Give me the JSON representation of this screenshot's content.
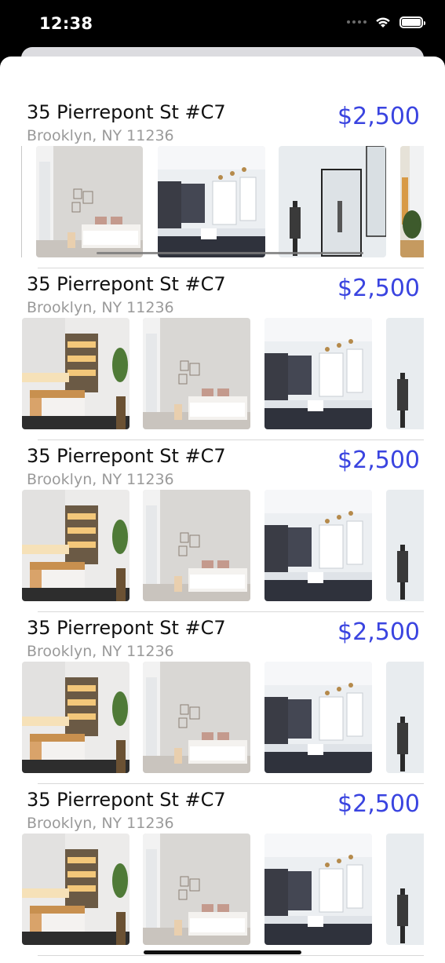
{
  "status_bar": {
    "time": "12:38",
    "icons": [
      "signal-dots-icon",
      "wifi-icon",
      "battery-icon"
    ]
  },
  "colors": {
    "price": "#3a44e0",
    "title": "#111111",
    "address": "#9a9a9a"
  },
  "listings": [
    {
      "title": "35 Pierrepont St #C7",
      "price": "$2,500",
      "address": "Brooklyn, NY 11236",
      "photos": [
        "bedroom-photo",
        "kitchen-photo",
        "bathroom-photo",
        "living-room-photo"
      ]
    },
    {
      "title": "35 Pierrepont St #C7",
      "price": "$2,500",
      "address": "Brooklyn, NY 11236",
      "photos": [
        "kitchen-island-photo",
        "bedroom-photo",
        "kitchen-photo",
        "bathroom-photo"
      ]
    },
    {
      "title": "35 Pierrepont St #C7",
      "price": "$2,500",
      "address": "Brooklyn, NY 11236",
      "photos": [
        "kitchen-island-photo",
        "bedroom-photo",
        "kitchen-photo",
        "bathroom-photo"
      ]
    },
    {
      "title": "35 Pierrepont St #C7",
      "price": "$2,500",
      "address": "Brooklyn, NY 11236",
      "photos": [
        "kitchen-island-photo",
        "bedroom-photo",
        "kitchen-photo",
        "bathroom-photo"
      ]
    },
    {
      "title": "35 Pierrepont St #C7",
      "price": "$2,500",
      "address": "Brooklyn, NY 11236",
      "photos": [
        "kitchen-island-photo",
        "bedroom-photo",
        "kitchen-photo",
        "bathroom-photo"
      ]
    }
  ]
}
